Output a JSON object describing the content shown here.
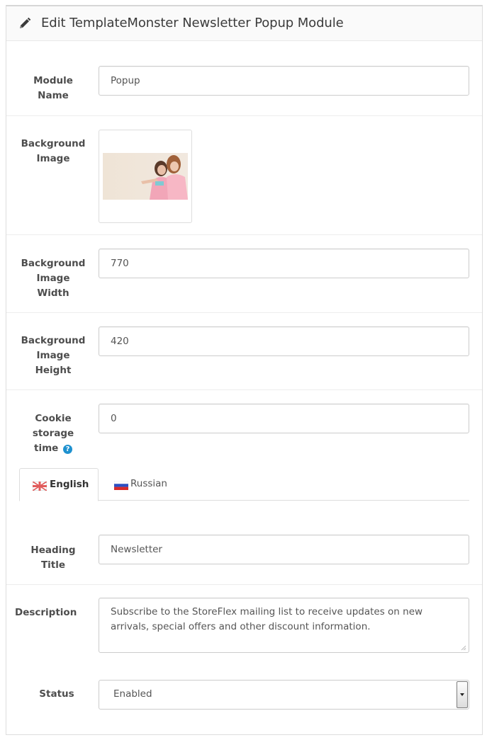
{
  "header": {
    "title": "Edit TemplateMonster Newsletter Popup Module",
    "icon": "pencil-icon"
  },
  "form": {
    "module_name": {
      "label_1": "Module",
      "label_2": "Name",
      "value": "Popup"
    },
    "background_image": {
      "label_1": "Background",
      "label_2": "Image"
    },
    "bg_width": {
      "label_1": "Background",
      "label_2": "Image",
      "label_3": "Width",
      "value": "770"
    },
    "bg_height": {
      "label_1": "Background",
      "label_2": "Image",
      "label_3": "Height",
      "value": "420"
    },
    "cookie": {
      "label_1": "Cookie",
      "label_2": "storage",
      "label_3": "time",
      "value": "0",
      "help_glyph": "?"
    },
    "tabs": [
      {
        "label": "English",
        "active": true,
        "flag": "uk-flag-icon"
      },
      {
        "label": "Russian",
        "active": false,
        "flag": "russia-flag-icon"
      }
    ],
    "heading_title": {
      "label_1": "Heading",
      "label_2": "Title",
      "value": "Newsletter"
    },
    "description": {
      "label": "Description",
      "value": "Subscribe to the StoreFlex mailing list to receive updates on new arrivals, special offers and other discount information."
    },
    "status": {
      "label": "Status",
      "value": "Enabled"
    }
  },
  "colors": {
    "accent_help": "#1e91cf",
    "border": "#cccccc",
    "label_text": "#4d4d4d"
  }
}
